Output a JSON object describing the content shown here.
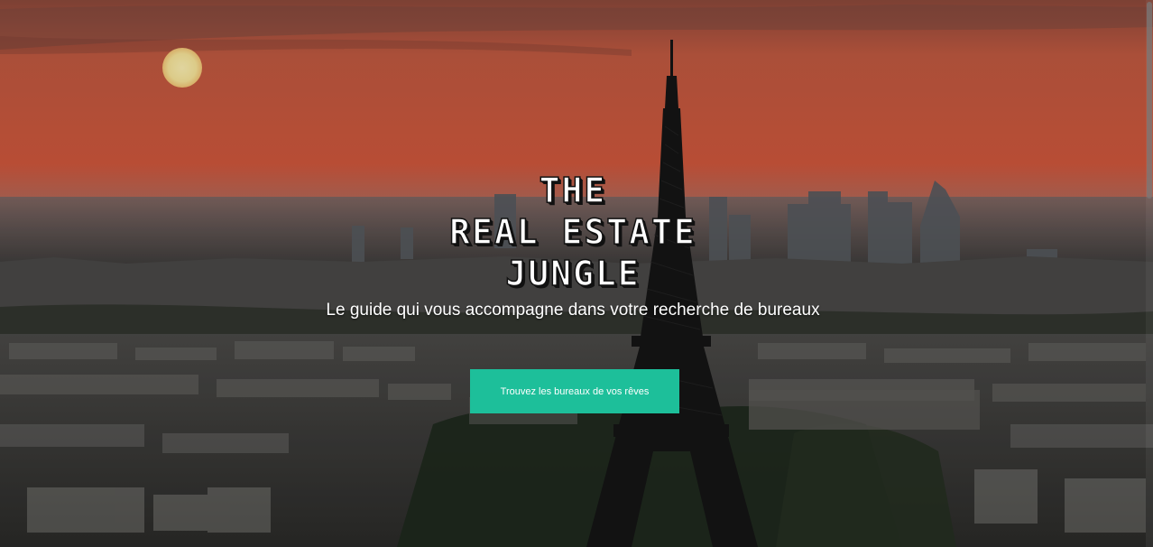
{
  "hero": {
    "title_lines": [
      "THE",
      "REAL ESTATE",
      "JUNGLE"
    ],
    "subtitle": "Le guide qui vous accompagne dans votre recherche de bureaux",
    "cta_label": "Trouvez les bureaux de vos rêves"
  },
  "colors": {
    "cta_background": "#1dbf9a",
    "text": "#ffffff",
    "sky": "#c85a3f"
  }
}
